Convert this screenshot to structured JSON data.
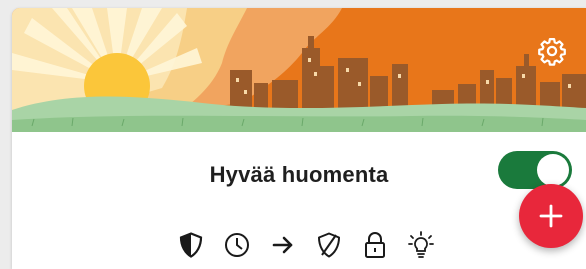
{
  "card": {
    "title": "Hyvää huomenta",
    "enabled": true
  },
  "icons": {
    "settings": "gear-icon",
    "add": "plus-icon",
    "sequence": [
      "shield-half-icon",
      "clock-icon",
      "arrow-right-icon",
      "shield-off-icon",
      "lock-icon",
      "lightbulb-icon"
    ]
  },
  "colors": {
    "banner_orange": "#e8761a",
    "toggle_on": "#1a7a3c",
    "fab": "#e8273b",
    "sun": "#fbc63a",
    "hill": "#a9d4a6"
  }
}
